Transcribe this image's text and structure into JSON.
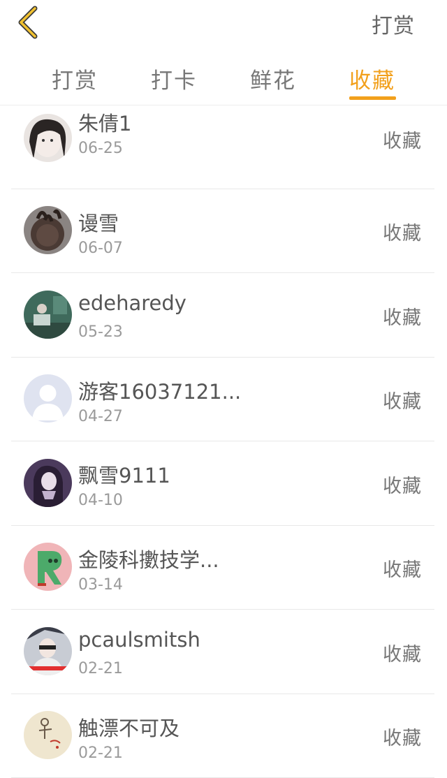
{
  "header": {
    "back_icon": "chevron-left-icon",
    "action_label": "打赏",
    "accent_color": "#f2a01c"
  },
  "tabs": [
    {
      "label": "打赏",
      "active": false
    },
    {
      "label": "打卡",
      "active": false
    },
    {
      "label": "鲜花",
      "active": false
    },
    {
      "label": "收藏",
      "active": true
    }
  ],
  "list": {
    "items": [
      {
        "name": "朱倩1",
        "date": "06-25",
        "action": "收藏",
        "avatar": "user-avatar-photo"
      },
      {
        "name": "谩雪",
        "date": "06-07",
        "action": "收藏",
        "avatar": "user-avatar-photo"
      },
      {
        "name": "edeharedy",
        "date": "05-23",
        "action": "收藏",
        "avatar": "user-avatar-photo"
      },
      {
        "name": "游客16037121...",
        "date": "04-27",
        "action": "收藏",
        "avatar": "default-avatar-icon"
      },
      {
        "name": "飘雪9111",
        "date": "04-10",
        "action": "收藏",
        "avatar": "user-avatar-photo"
      },
      {
        "name": "金陵科擻技学...",
        "date": "03-14",
        "action": "收藏",
        "avatar": "user-avatar-photo"
      },
      {
        "name": "pcaulsmitsh",
        "date": "02-21",
        "action": "收藏",
        "avatar": "user-avatar-photo"
      },
      {
        "name": "触漂不可及",
        "date": "02-21",
        "action": "收藏",
        "avatar": "user-avatar-photo"
      }
    ]
  }
}
